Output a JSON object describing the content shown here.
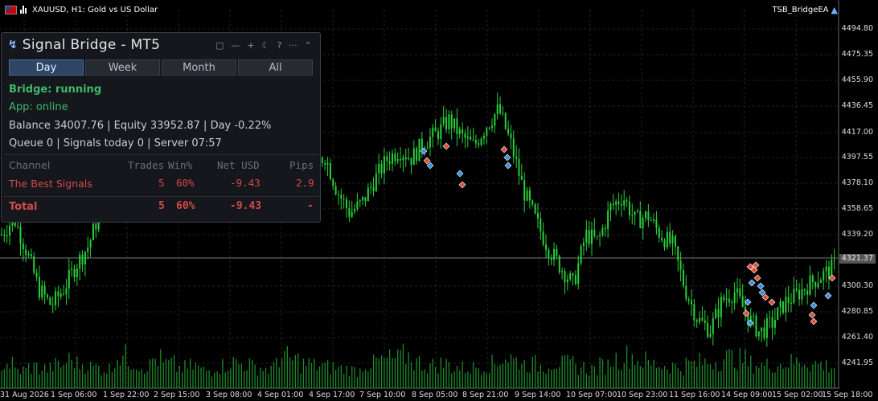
{
  "chart_header": {
    "symbol_line": "XAUUSD, H1:  Gold vs US Dollar",
    "ea_name": "TSB_BridgeEA"
  },
  "price_axis": {
    "labels": [
      "4494.80",
      "4475.35",
      "4455.90",
      "4436.45",
      "4417.00",
      "4397.55",
      "4378.10",
      "4358.65",
      "4339.20",
      "4321.37",
      "4300.30",
      "4280.85",
      "4261.40",
      "4241.95"
    ],
    "current_price": "4321.37"
  },
  "time_axis": {
    "labels": [
      "31 Aug 2026",
      "1 Sep 06:00",
      "1 Sep 22:00",
      "2 Sep 15:00",
      "3 Sep 08:00",
      "4 Sep 01:00",
      "4 Sep 17:00",
      "7 Sep 10:00",
      "8 Sep 05:00",
      "8 Sep 21:00",
      "9 Sep 14:00",
      "10 Sep 07:00",
      "10 Sep 23:00",
      "11 Sep 16:00",
      "14 Sep 09:00",
      "15 Sep 02:00",
      "15 Sep 18:00"
    ]
  },
  "colors": {
    "background": "#000000",
    "candle": "#27d13a",
    "volume": "#1f8a2c",
    "grid": "#2a2a2a",
    "panel_bg": "#15171c",
    "accent_tab": "#2f4566",
    "status_green": "#3fb86a",
    "loss_red": "#d24a4a",
    "buy_marker": "#3a8ee6",
    "sell_marker": "#e0503a"
  },
  "chart_data": {
    "type": "candlestick",
    "series_name": "XAUUSD H1",
    "ylim": [
      4235,
      4505
    ],
    "close_path_approx": [
      4340,
      4352,
      4328,
      4300,
      4288,
      4300,
      4318,
      4332,
      4360,
      4385,
      4402,
      4415,
      4470,
      4405,
      4420,
      4408,
      4400,
      4398,
      4395,
      4402,
      4412,
      4435,
      4415,
      4395,
      4385,
      4388,
      4398,
      4372,
      4356,
      4363,
      4380,
      4395,
      4402,
      4396,
      4408,
      4414,
      4424,
      4412,
      4405,
      4420,
      4432,
      4406,
      4372,
      4350,
      4330,
      4316,
      4303,
      4340,
      4335,
      4360,
      4368,
      4350,
      4354,
      4340,
      4332,
      4300,
      4278,
      4270,
      4292,
      4298,
      4280,
      4268,
      4275,
      4290,
      4296,
      4304,
      4310,
      4316
    ],
    "volume_approx": [
      30,
      22,
      26,
      24,
      28,
      35,
      30,
      26,
      24,
      40,
      33,
      28,
      36,
      30,
      25,
      27,
      22,
      28,
      32,
      30,
      26,
      24,
      38,
      35,
      30,
      28,
      26,
      24,
      22,
      30,
      34,
      36,
      40,
      32,
      28,
      30,
      26,
      25,
      27,
      30,
      38,
      34,
      30,
      28,
      32,
      30,
      26,
      24,
      28,
      36,
      40,
      34,
      30,
      28,
      26,
      30,
      32,
      34,
      38,
      36,
      30,
      28,
      30,
      32,
      34,
      30,
      28,
      26
    ]
  },
  "panel": {
    "title": "Signal Bridge - MT5",
    "icons": [
      "screen-icon",
      "minimize-icon",
      "plus-icon",
      "moon-icon",
      "help-icon",
      "more-icon",
      "collapse-icon"
    ],
    "tabs": [
      {
        "label": "Day",
        "active": true
      },
      {
        "label": "Week",
        "active": false
      },
      {
        "label": "Month",
        "active": false
      },
      {
        "label": "All",
        "active": false
      }
    ],
    "bridge_status": "Bridge: running",
    "app_status": "App: online",
    "account_line": "Balance 34007.76  |  Equity 33952.87  |  Day -0.22%",
    "queue_line": "Queue 0  |  Signals today 0  |  Server 07:57",
    "table": {
      "headers": {
        "channel": "Channel",
        "trades": "Trades",
        "win": "Win%",
        "net": "Net USD",
        "pips": "Pips"
      },
      "rows": [
        {
          "channel": "The Best Signals",
          "trades": "5",
          "win": "60%",
          "net": "-9.43",
          "pips": "2.9"
        }
      ],
      "total": {
        "channel": "Total",
        "trades": "5",
        "win": "60%",
        "net": "-9.43",
        "pips": "-"
      }
    }
  }
}
